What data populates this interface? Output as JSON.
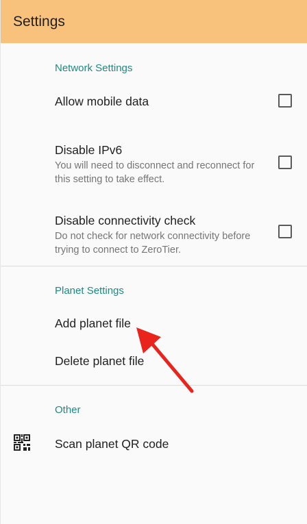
{
  "appbar": {
    "title": "Settings"
  },
  "network": {
    "section_title": "Network Settings",
    "allow_mobile_data": {
      "title": "Allow mobile data",
      "checked": false
    },
    "disable_ipv6": {
      "title": "Disable IPv6",
      "summary": "You will need to disconnect and reconnect for this setting to take effect.",
      "checked": false
    },
    "disable_connectivity_check": {
      "title": "Disable connectivity check",
      "summary": "Do not check for network connectivity before trying to connect to ZeroTier.",
      "checked": false
    }
  },
  "planet": {
    "section_title": "Planet Settings",
    "add_planet_file": "Add planet file",
    "delete_planet_file": "Delete planet file"
  },
  "other": {
    "section_title": "Other",
    "scan_planet_qr": {
      "title": "Scan planet QR code",
      "icon": "qr-code-icon"
    }
  },
  "annotation": {
    "arrow_color": "#e8241c"
  }
}
